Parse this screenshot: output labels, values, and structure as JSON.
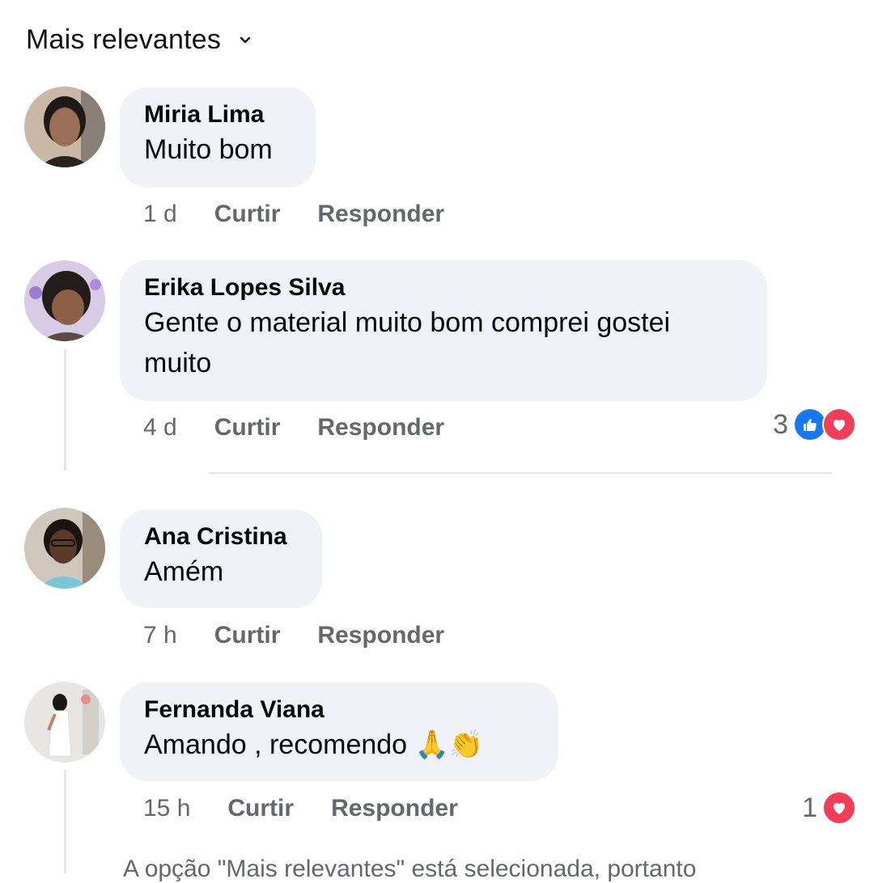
{
  "sort": {
    "label": "Mais relevantes"
  },
  "actions": {
    "like": "Curtir",
    "reply": "Responder"
  },
  "comments": [
    {
      "author": "Miria Lima",
      "text": "Muito bom",
      "time": "1 d"
    },
    {
      "author": "Erika Lopes Silva",
      "text": "Gente o material muito bom comprei gostei muito",
      "time": "4 d",
      "reactions": {
        "count": "3",
        "types": [
          "like-icon",
          "love-icon"
        ]
      }
    },
    {
      "author": "Ana Cristina",
      "text": "Amém",
      "time": "7 h"
    },
    {
      "author": "Fernanda Viana",
      "text": "Amando , recomendo",
      "emojis": "🙏👏",
      "time": "15 h",
      "reactions": {
        "count": "1",
        "types": [
          "love-icon"
        ]
      }
    }
  ],
  "footnote": "A opção \"Mais relevantes\" está selecionada, portanto",
  "colors": {
    "bubble": "#f0f2f5",
    "meta": "#65676b",
    "like": "#1877f2",
    "love": "#f33e58"
  }
}
